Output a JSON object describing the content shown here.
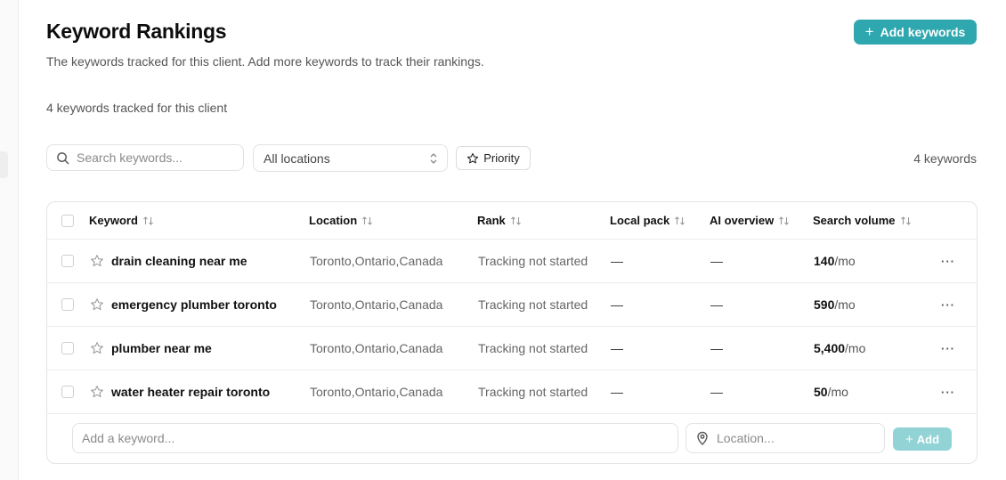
{
  "page": {
    "title": "Keyword Rankings",
    "subtitle": "The keywords tracked for this client. Add more keywords to track their rankings.",
    "tracked_summary": "4 keywords tracked for this client",
    "add_keywords_label": "Add keywords"
  },
  "filters": {
    "search_placeholder": "Search keywords...",
    "location_value": "All locations",
    "priority_label": "Priority",
    "result_count": "4 keywords"
  },
  "table": {
    "columns": {
      "keyword": "Keyword",
      "location": "Location",
      "rank": "Rank",
      "local_pack": "Local pack",
      "ai_overview": "AI overview",
      "search_volume": "Search volume"
    },
    "rows": [
      {
        "keyword": "drain cleaning near me",
        "location": "Toronto,Ontario,Canada",
        "rank": "Tracking not started",
        "local_pack": "—",
        "ai_overview": "—",
        "volume": "140",
        "volume_unit": "/mo"
      },
      {
        "keyword": "emergency plumber toronto",
        "location": "Toronto,Ontario,Canada",
        "rank": "Tracking not started",
        "local_pack": "—",
        "ai_overview": "—",
        "volume": "590",
        "volume_unit": "/mo"
      },
      {
        "keyword": "plumber near me",
        "location": "Toronto,Ontario,Canada",
        "rank": "Tracking not started",
        "local_pack": "—",
        "ai_overview": "—",
        "volume": "5,400",
        "volume_unit": "/mo"
      },
      {
        "keyword": "water heater repair toronto",
        "location": "Toronto,Ontario,Canada",
        "rank": "Tracking not started",
        "local_pack": "—",
        "ai_overview": "—",
        "volume": "50",
        "volume_unit": "/mo"
      }
    ],
    "row_menu": "···"
  },
  "add_row": {
    "keyword_placeholder": "Add a keyword...",
    "location_placeholder": "Location...",
    "add_label": "Add"
  },
  "colors": {
    "accent": "#2ea7ae",
    "accent_disabled": "#92d3d6"
  },
  "icons": {
    "add_keywords": "plus-icon",
    "search": "search-icon",
    "select": "chevron-updown-icon",
    "priority": "star-icon",
    "sort": "sort-arrows-icon",
    "row_star": "star-outline-icon",
    "row_menu": "more-horizontal-icon",
    "location": "map-pin-icon",
    "add": "plus-icon"
  }
}
